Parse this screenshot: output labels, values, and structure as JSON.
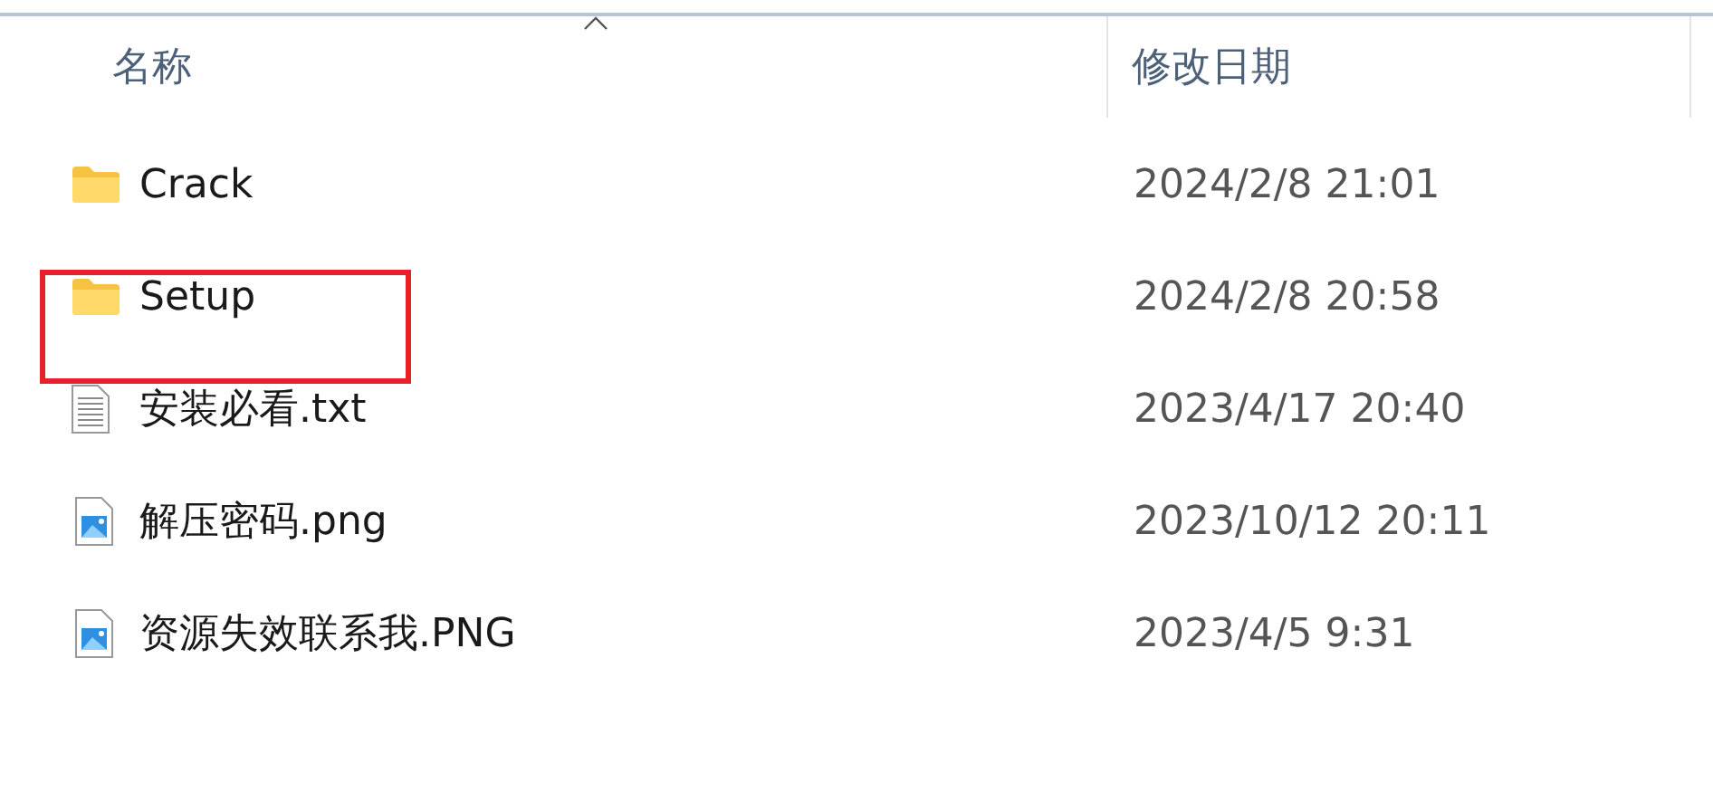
{
  "columns": [
    {
      "label": "名称",
      "sorted": true
    },
    {
      "label": "修改日期",
      "sorted": false
    }
  ],
  "files": [
    {
      "name": "Crack",
      "kind": "folder",
      "modified": "2024/2/8 21:01",
      "highlighted": false
    },
    {
      "name": "Setup",
      "kind": "folder",
      "modified": "2024/2/8 20:58",
      "highlighted": true
    },
    {
      "name": "安装必看.txt",
      "kind": "text",
      "modified": "2023/4/17 20:40",
      "highlighted": false
    },
    {
      "name": "解压密码.png",
      "kind": "image",
      "modified": "2023/10/12 20:11",
      "highlighted": false
    },
    {
      "name": "资源失效联系我.PNG",
      "kind": "image",
      "modified": "2023/4/5 9:31",
      "highlighted": false
    }
  ]
}
